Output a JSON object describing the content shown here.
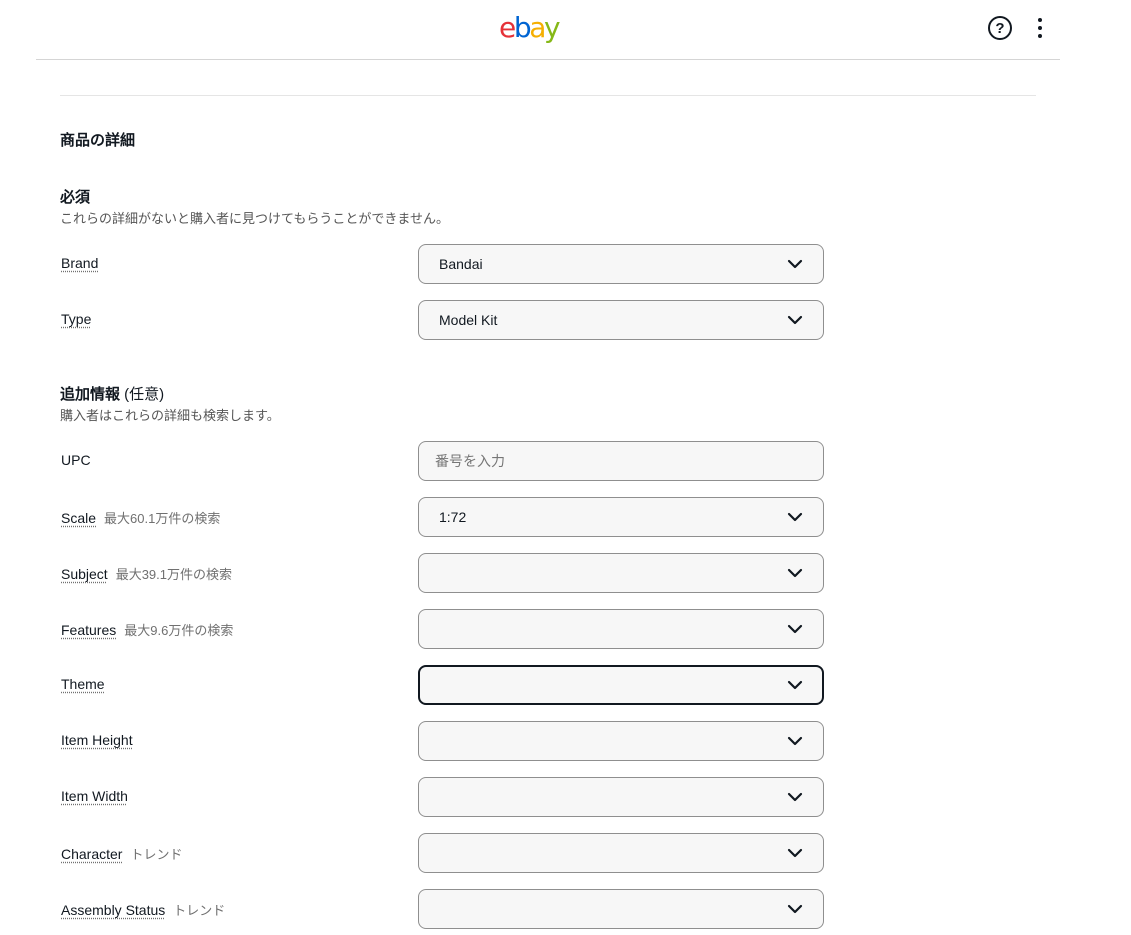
{
  "header": {
    "logo": {
      "e": "e",
      "b": "b",
      "a": "a",
      "y": "y"
    },
    "help_icon": "question-circle-icon",
    "more_icon": "kebab-menu-icon",
    "help_glyph": "?"
  },
  "section_title": "商品の詳細",
  "required": {
    "title": "必須",
    "subtitle": "これらの詳細がないと購入者に見つけてもらうことができません。",
    "fields": [
      {
        "label": "Brand",
        "value": "Bandai"
      },
      {
        "label": "Type",
        "value": "Model Kit"
      }
    ]
  },
  "optional": {
    "title": "追加情報",
    "title_suffix": " (任意)",
    "subtitle": "購入者はこれらの詳細も検索します。",
    "upc": {
      "label": "UPC",
      "placeholder": "番号を入力",
      "value": ""
    },
    "fields": [
      {
        "label": "Scale",
        "hint": "最大60.1万件の検索",
        "value": "1:72"
      },
      {
        "label": "Subject",
        "hint": "最大39.1万件の検索",
        "value": ""
      },
      {
        "label": "Features",
        "hint": "最大9.6万件の検索",
        "value": ""
      },
      {
        "label": "Theme",
        "hint": "",
        "value": ""
      },
      {
        "label": "Item Height",
        "hint": "",
        "value": ""
      },
      {
        "label": "Item Width",
        "hint": "",
        "value": ""
      },
      {
        "label": "Character",
        "hint": "トレンド",
        "value": ""
      },
      {
        "label": "Assembly Status",
        "hint": "トレンド",
        "value": ""
      }
    ]
  },
  "colors": {
    "ebay_red": "#e53238",
    "ebay_blue": "#0064d2",
    "ebay_yellow": "#f5af02",
    "ebay_green": "#86b817",
    "field_bg": "#f7f7f7",
    "field_border": "#8f8f8f",
    "focus_border": "#111820"
  }
}
